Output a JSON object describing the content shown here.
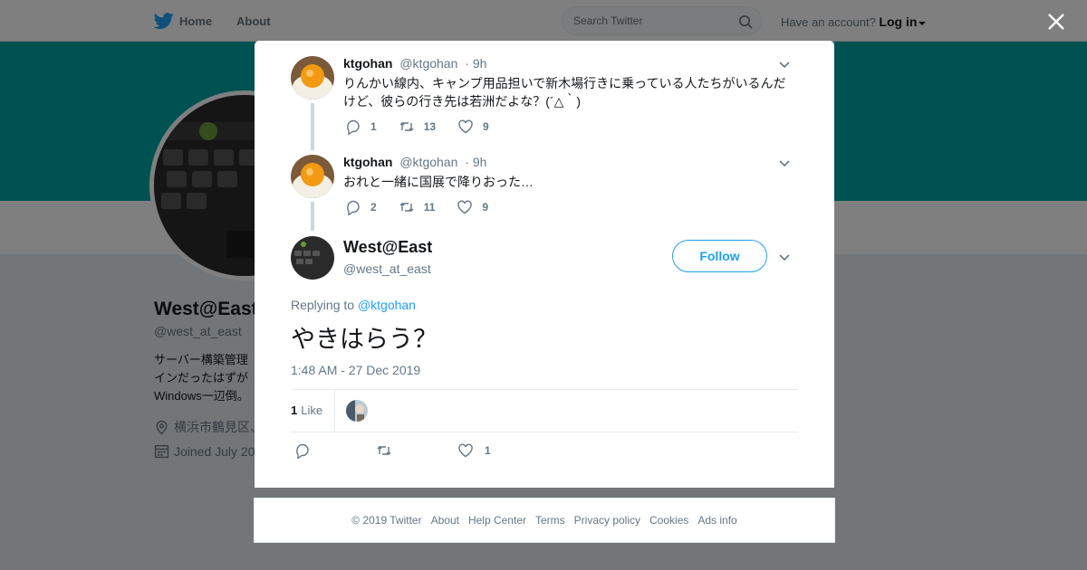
{
  "topbar": {
    "home_label": "Home",
    "about_label": "About",
    "search_placeholder": "Search Twitter",
    "have_account": "Have an account?",
    "login_label": "Log in"
  },
  "profile": {
    "name": "West@East",
    "handle": "@west_at_east",
    "bio_lines": [
      "サーバー構築管理",
      "インだったはずが",
      "Windows一辺倒。"
    ],
    "location": "横浜市鶴見区、",
    "joined": "Joined July 20"
  },
  "thread": [
    {
      "name": "ktgohan",
      "handle": "@ktgohan",
      "time": "· 9h",
      "text": "りんかい線内、キャンプ用品担いで新木場行きに乗っている人たちがいるんだけど、彼らの行き先は若洲だよな？(´△｀)",
      "replies": "1",
      "retweets": "13",
      "likes": "9"
    },
    {
      "name": "ktgohan",
      "handle": "@ktgohan",
      "time": "· 9h",
      "text": "おれと一緒に国展で降りおった…",
      "replies": "2",
      "retweets": "11",
      "likes": "9"
    }
  ],
  "main_tweet": {
    "name": "West@East",
    "handle": "@west_at_east",
    "follow_label": "Follow",
    "replying_prefix": "Replying to",
    "replying_handle": "@ktgohan",
    "text": "やきはらう？",
    "timestamp": "1:48 AM - 27 Dec 2019",
    "likes_count": "1",
    "likes_label": "Like",
    "action_likes": "1"
  },
  "footer": {
    "links": [
      "© 2019 Twitter",
      "About",
      "Help Center",
      "Terms",
      "Privacy policy",
      "Cookies",
      "Ads info"
    ]
  },
  "colors": {
    "accent": "#1da1f2",
    "banner": "#00a2a2",
    "thread_line": "#ccd6dd"
  }
}
